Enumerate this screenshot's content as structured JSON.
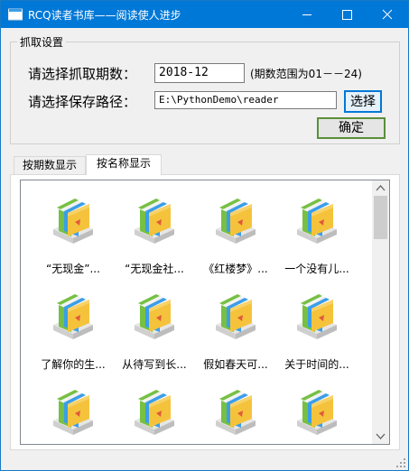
{
  "window": {
    "title": "RCQ读者书库——阅读使人进步",
    "controls": [
      "minimize",
      "maximize",
      "close"
    ]
  },
  "group": {
    "legend": "抓取设置",
    "period_label": "请选择抓取期数：",
    "period_value": "2018-12",
    "period_hint": "(期数范围为01－－24)",
    "path_label": "请选择保存路径：",
    "path_value": "E:\\PythonDemo\\reader",
    "select_button": "选择",
    "ok_button": "确定"
  },
  "tabs": [
    {
      "label": "按期数显示",
      "active": false
    },
    {
      "label": "按名称显示",
      "active": true
    }
  ],
  "items": [
    {
      "label": "“无现金”..."
    },
    {
      "label": "“无现金社..."
    },
    {
      "label": "《红楼梦》..."
    },
    {
      "label": "一个没有儿..."
    },
    {
      "label": "了解你的生..."
    },
    {
      "label": "从待写到长..."
    },
    {
      "label": "假如春天可..."
    },
    {
      "label": "关于时间的..."
    },
    {
      "label": ""
    },
    {
      "label": ""
    },
    {
      "label": ""
    },
    {
      "label": ""
    }
  ],
  "icons": {
    "folder": "book-folder-icon",
    "app": "app-icon"
  },
  "colors": {
    "titlebar": "#0078d7",
    "folder_yellow": "#f5c33b",
    "book_green": "#77c043",
    "book_blue": "#3b9ee8",
    "ok_border": "#5a8f3a",
    "select_border": "#0078d7"
  }
}
